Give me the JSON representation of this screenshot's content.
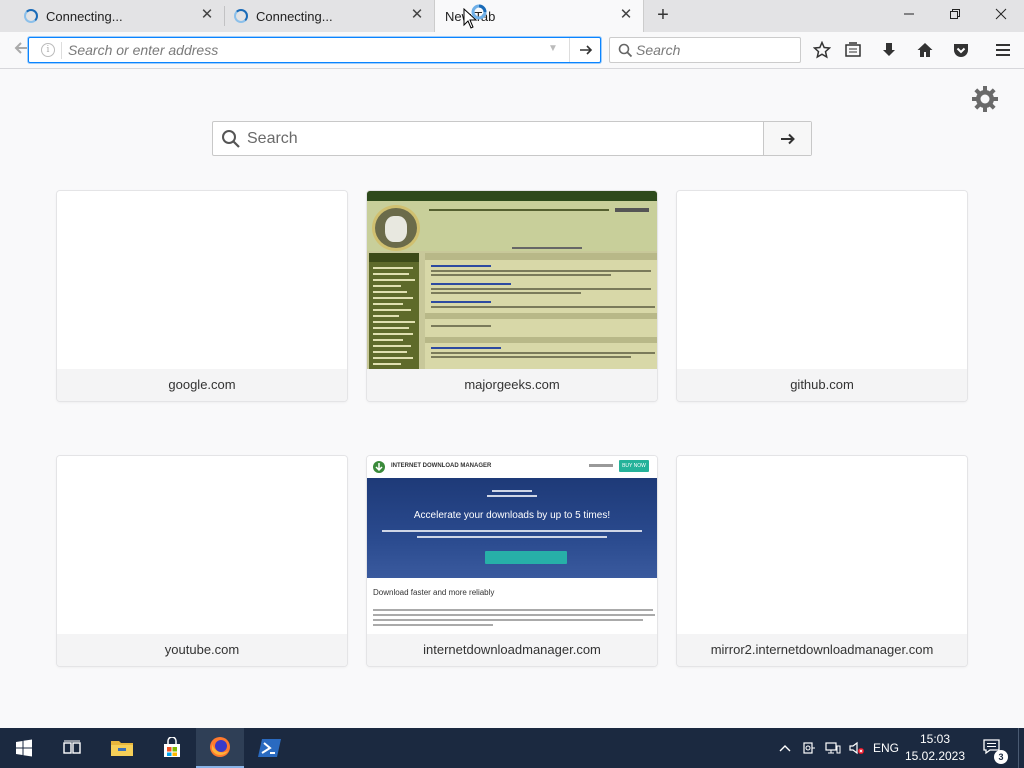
{
  "tabs": [
    {
      "title": "Connecting...",
      "state": "loading"
    },
    {
      "title": "Connecting...",
      "state": "loading"
    },
    {
      "title": "New Tab",
      "state": "active"
    }
  ],
  "navbar": {
    "url_placeholder": "Search or enter address",
    "search_placeholder": "Search"
  },
  "content": {
    "search_placeholder": "Search",
    "tiles": [
      {
        "label": "google.com",
        "thumbnail": "blank"
      },
      {
        "label": "majorgeeks.com",
        "thumbnail": "majorgeeks-site"
      },
      {
        "label": "github.com",
        "thumbnail": "blank"
      },
      {
        "label": "youtube.com",
        "thumbnail": "blank"
      },
      {
        "label": "internetdownloadmanager.com",
        "thumbnail": "idm-site"
      },
      {
        "label": "mirror2.internetdownloadmanager.com",
        "thumbnail": "blank"
      }
    ],
    "idm_thumb": {
      "brand": "INTERNET DOWNLOAD MANAGER",
      "headline": "Accelerate your downloads by up to 5 times!",
      "subheadline": "Download faster and more reliably",
      "cta": "BUY NOW"
    }
  },
  "taskbar": {
    "apps": [
      "start-icon",
      "task-view-icon",
      "file-explorer-icon",
      "store-icon",
      "firefox-icon",
      "powershell-icon"
    ],
    "language": "ENG",
    "time": "15:03",
    "date": "15.02.2023",
    "notification_count": "3"
  },
  "colors": {
    "accent": "#0a84ff",
    "taskbar": "#1b2940",
    "tabstrip": "#e3e3e5"
  }
}
